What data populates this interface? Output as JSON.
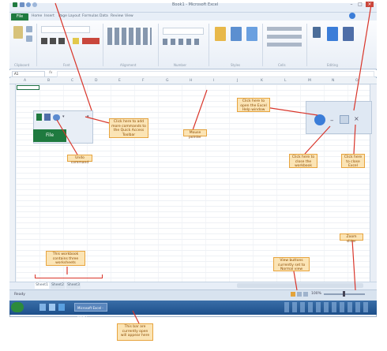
{
  "window": {
    "title": "Book1 - Microsoft Excel",
    "controls": [
      "–",
      "□",
      "×"
    ]
  },
  "ribbon": {
    "file_tab": "File",
    "tabs": [
      "Home",
      "Insert",
      "Page Layout",
      "Formulas",
      "Data",
      "Review",
      "View"
    ],
    "group_labels": [
      "Clipboard",
      "Font",
      "Alignment",
      "Number",
      "Styles",
      "Cells",
      "Editing"
    ]
  },
  "formula_bar": {
    "name_box": "A1",
    "fx": "fx"
  },
  "column_headers": [
    "A",
    "B",
    "C",
    "D",
    "E",
    "F",
    "G",
    "H",
    "I",
    "J",
    "K",
    "L",
    "M",
    "N",
    "O"
  ],
  "sheet_tabs": [
    "Sheet1",
    "Sheet2",
    "Sheet3"
  ],
  "status": {
    "ready": "Ready",
    "zoom": "100%"
  },
  "taskbar": {
    "app_label": "Microsoft Excel - Book1"
  },
  "inset": {
    "file_label": "File"
  },
  "callouts": {
    "qat_add": "Click here to add more commands to the Quick Access Toolbar",
    "mouse_pointer": "Mouse pointer",
    "open_help": "Click here to open the Excel Help window",
    "undo": "Undo command",
    "close_workbook": "Click here to close the workbook",
    "close_excel": "Click here to close Excel",
    "sheets": "This workbook contains three worksheets",
    "view_buttons": "View buttons currently set to Normal view",
    "zoom_slider": "Zoom slider",
    "taskbar_note": "This bar are currently open will appear here"
  },
  "colors": {
    "excel_green": "#1f7a3f",
    "callout_fill": "#fbe4b5",
    "callout_border": "#e7a43e",
    "arrow_red": "#d9352a",
    "taskbar_blue": "#1d4f8a"
  }
}
